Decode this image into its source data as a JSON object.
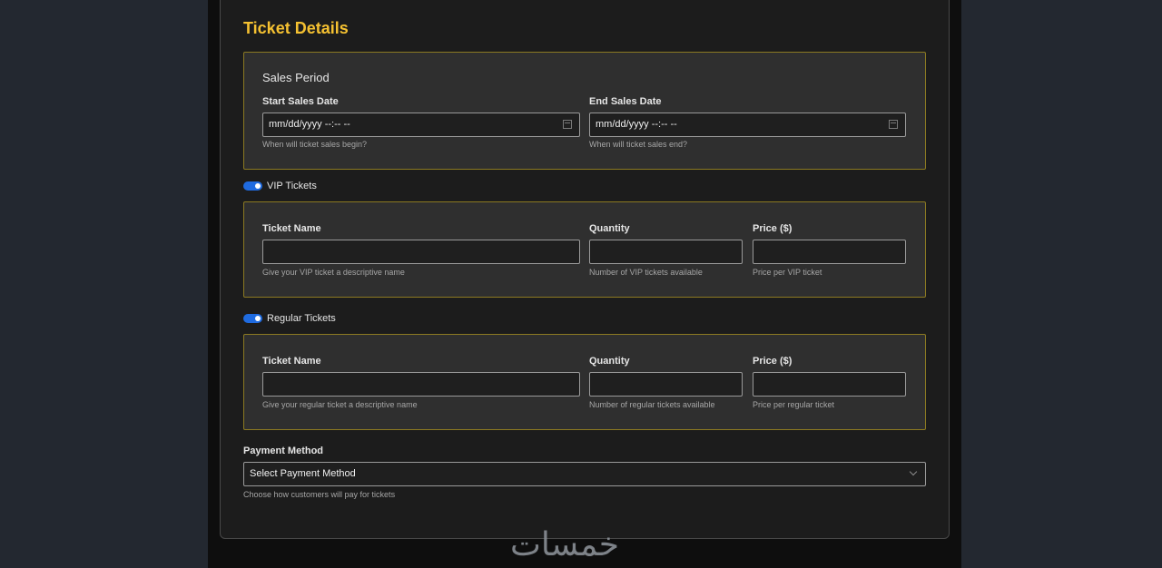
{
  "page": {
    "title": "Ticket Details"
  },
  "sales_period": {
    "title": "Sales Period",
    "start": {
      "label": "Start Sales Date",
      "placeholder": "mm/dd/yyyy --:-- --",
      "help": "When will ticket sales begin?"
    },
    "end": {
      "label": "End Sales Date",
      "placeholder": "mm/dd/yyyy --:-- --",
      "help": "When will ticket sales end?"
    }
  },
  "vip": {
    "toggle_label": "VIP Tickets",
    "enabled": true,
    "name": {
      "label": "Ticket Name",
      "value": "",
      "help": "Give your VIP ticket a descriptive name"
    },
    "quantity": {
      "label": "Quantity",
      "value": "",
      "help": "Number of VIP tickets available"
    },
    "price": {
      "label": "Price ($)",
      "value": "",
      "help": "Price per VIP ticket"
    }
  },
  "regular": {
    "toggle_label": "Regular Tickets",
    "enabled": true,
    "name": {
      "label": "Ticket Name",
      "value": "",
      "help": "Give your regular ticket a descriptive name"
    },
    "quantity": {
      "label": "Quantity",
      "value": "",
      "help": "Number of regular tickets available"
    },
    "price": {
      "label": "Price ($)",
      "value": "",
      "help": "Price per regular ticket"
    }
  },
  "payment": {
    "label": "Payment Method",
    "selected": "Select Payment Method",
    "help": "Choose how customers will pay for tickets"
  },
  "watermark": {
    "text": "خمسات"
  },
  "colors": {
    "accent": "#f5c131",
    "toggle": "#1f6be0",
    "section_border": "#8c7a22",
    "background": "#232830"
  }
}
